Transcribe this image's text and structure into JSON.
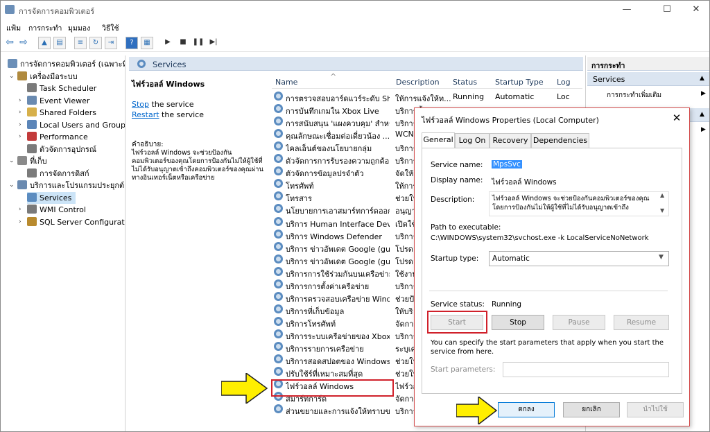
{
  "window": {
    "title": "การจัดการคอมพิวเตอร์",
    "minimize": "—",
    "maximize": "☐",
    "close": "✕"
  },
  "menu": [
    "แฟ้ม",
    "การกระทำ",
    "มุมมอง",
    "วิธีใช้"
  ],
  "tree": [
    {
      "label": "การจัดการคอมพิวเตอร์ (เฉพาะที่)",
      "level": 0,
      "color": "#6b8fb8"
    },
    {
      "label": "เครื่องมือระบบ",
      "level": 1,
      "color": "#b08a3e",
      "expanded": true
    },
    {
      "label": "Task Scheduler",
      "level": 2,
      "color": "#7a7a7a"
    },
    {
      "label": "Event Viewer",
      "level": 2,
      "color": "#6a8ab0"
    },
    {
      "label": "Shared Folders",
      "level": 2,
      "color": "#d7b04a"
    },
    {
      "label": "Local Users and Groups",
      "level": 2,
      "color": "#5b85b8"
    },
    {
      "label": "Performance",
      "level": 2,
      "color": "#c23b3b"
    },
    {
      "label": "ตัวจัดการอุปกรณ์",
      "level": 2,
      "color": "#7b7b7b"
    },
    {
      "label": "ที่เก็บ",
      "level": 1,
      "color": "#8a8a8a",
      "expanded": true
    },
    {
      "label": "การจัดการดิสก์",
      "level": 2,
      "color": "#7b7b7b"
    },
    {
      "label": "บริการและโปรแกรมประยุกต์",
      "level": 1,
      "color": "#6a8ab0",
      "expanded": true
    },
    {
      "label": "Services",
      "level": 2,
      "color": "#5b8cc0",
      "selected": true
    },
    {
      "label": "WMI Control",
      "level": 2,
      "color": "#7a7a7a"
    },
    {
      "label": "SQL Server Configuratic",
      "level": 2,
      "color": "#b88a2e"
    }
  ],
  "services_panel": {
    "header": "Services",
    "selected_name": "ไฟร์วอลล์ Windows",
    "stop_link": "Stop",
    "stop_rest": " the service",
    "restart_link": "Restart",
    "restart_rest": " the service",
    "desc_label": "คำอธิบาย:",
    "desc_text": "ไฟร์วอลล์ Windows จะช่วยป้องกันคอมพิวเตอร์ของคุณโดยการป้องกันไม่ให้ผู้ใช้ที่ไม่ได้รับอนุญาตเข้าถึงคอมพิวเตอร์ของคุณผ่านทางอินเทอร์เน็ตหรือเครือข่าย",
    "columns": [
      "Name",
      "Description",
      "Status",
      "Startup Type",
      "Log"
    ],
    "rows": [
      {
        "name": "การตรวจสอบอาร์ดแวร์ระดับ Shell",
        "desc": "ให้การแจ้งให้ท...",
        "status": "Running",
        "startup": "Automatic",
        "log": "Loc"
      },
      {
        "name": "การบันทึกเกมใน Xbox Live",
        "desc": "บริการนี้",
        "status": "",
        "startup": "",
        "log": ""
      },
      {
        "name": "การสนับสนุน 'แผงควบคุม' สำหรั...",
        "desc": "บริการ",
        "status": "",
        "startup": "",
        "log": ""
      },
      {
        "name": "คุณลักษณะเชื่อมต่อเดี่ยวน้อง ...",
        "desc": "WCN",
        "status": "",
        "startup": "",
        "log": ""
      },
      {
        "name": "ไคลเอ็นต์ของนโยบายกลุ่ม",
        "desc": "บริการ",
        "status": "",
        "startup": "",
        "log": ""
      },
      {
        "name": "ตัวจัดการการรับรองความถูกต้อง ...",
        "desc": "บริการ",
        "status": "",
        "startup": "",
        "log": ""
      },
      {
        "name": "ตัวจัดการข้อมูลปรจำตัว",
        "desc": "จัดให้",
        "status": "",
        "startup": "",
        "log": ""
      },
      {
        "name": "โทรศัพท์",
        "desc": "ให้การ",
        "status": "",
        "startup": "",
        "log": ""
      },
      {
        "name": "โทรสาร",
        "desc": "ช่วยให้",
        "status": "",
        "startup": "",
        "log": ""
      },
      {
        "name": "นโยบายการเอาสมาร์ทการ์ดออก",
        "desc": "อนุญา",
        "status": "",
        "startup": "",
        "log": ""
      },
      {
        "name": "บริการ Human Interface Devi...",
        "desc": "เปิดใช้",
        "status": "",
        "startup": "",
        "log": ""
      },
      {
        "name": "บริการ Windows Defender",
        "desc": "บริการ",
        "status": "",
        "startup": "",
        "log": ""
      },
      {
        "name": "บริการ ข่าวอัพเดต Google (gu...",
        "desc": "โปรดอ",
        "status": "",
        "startup": "",
        "log": ""
      },
      {
        "name": "บริการ ข่าวอัพเดต Google (gu...",
        "desc": "โปรดอ",
        "status": "",
        "startup": "",
        "log": ""
      },
      {
        "name": "บริการการใช้ร่วมกันบนเครือข่าย...",
        "desc": "ใช้งาน",
        "status": "",
        "startup": "",
        "log": ""
      },
      {
        "name": "บริการการตั้งค่าเครือข่าย",
        "desc": "บริการ",
        "status": "",
        "startup": "",
        "log": ""
      },
      {
        "name": "บริการตรวจสอบเครือข่าย Wind...",
        "desc": "ช่วยป้อ",
        "status": "",
        "startup": "",
        "log": ""
      },
      {
        "name": "บริการที่เก็บข้อมูล",
        "desc": "ให้บริ",
        "status": "",
        "startup": "",
        "log": ""
      },
      {
        "name": "บริการโทรศัพท์",
        "desc": "จัดการ",
        "status": "",
        "startup": "",
        "log": ""
      },
      {
        "name": "บริการระบบเครือข่ายของ Xbox L...",
        "desc": "บริการ",
        "status": "",
        "startup": "",
        "log": ""
      },
      {
        "name": "บริการรายการเครือข่าย",
        "desc": "ระบุเค",
        "status": "",
        "startup": "",
        "log": ""
      },
      {
        "name": "บริการสอดสปอตของ Windows ...",
        "desc": "ช่วยให้",
        "status": "",
        "startup": "",
        "log": ""
      },
      {
        "name": "ปรับใช้ร์ที่เหมาะสมที่สุด",
        "desc": "ช่วยให้",
        "status": "",
        "startup": "",
        "log": ""
      },
      {
        "name": "ไฟร์วอลล์ Windows",
        "desc": "ไฟร์วอ",
        "status": "",
        "startup": "",
        "log": "",
        "highlight": true
      },
      {
        "name": "สมาร์ทการ์ด",
        "desc": "จัดการ",
        "status": "",
        "startup": "",
        "log": ""
      },
      {
        "name": "ส่วนขยายและการแจ้งให้ทราบของ...",
        "desc": "บริการ",
        "status": "",
        "startup": "",
        "log": ""
      }
    ]
  },
  "actions_panel": {
    "header": "การกระทำ",
    "section1": "Services",
    "more_actions": "การกระทำเพิ่มเติม"
  },
  "dialog": {
    "title": "ไฟร์วอลล์ Windows Properties (Local Computer)",
    "close": "✕",
    "tabs": [
      "General",
      "Log On",
      "Recovery",
      "Dependencies"
    ],
    "service_name_label": "Service name:",
    "service_name": "MpsSvc",
    "display_name_label": "Display name:",
    "display_name": "ไฟร์วอลล์ Windows",
    "description_label": "Description:",
    "description": "ไฟร์วอลล์ Windows จะช่วยป้องกันคอมพิวเตอร์ของคุณโดยการป้องกันไม่ให้ผู้ใช้ที่ไม่ได้รับอนุญาตเข้าถึง",
    "path_label": "Path to executable:",
    "path": "C:\\WINDOWS\\system32\\svchost.exe -k LocalServiceNoNetwork",
    "startup_label": "Startup type:",
    "startup_value": "Automatic",
    "status_label": "Service status:",
    "status_value": "Running",
    "btn_start": "Start",
    "btn_stop": "Stop",
    "btn_pause": "Pause",
    "btn_resume": "Resume",
    "hint": "You can specify the start parameters that apply when you start the service from here.",
    "params_label": "Start parameters:",
    "params_value": "",
    "btn_ok": "ตกลง",
    "btn_cancel": "ยกเลิก",
    "btn_apply": "นำไปใช้"
  },
  "colors": {
    "accent": "#0066cc",
    "highlight_box": "#d0202a",
    "arrow": "#ffef00",
    "header_bg": "#dbe5f1"
  }
}
